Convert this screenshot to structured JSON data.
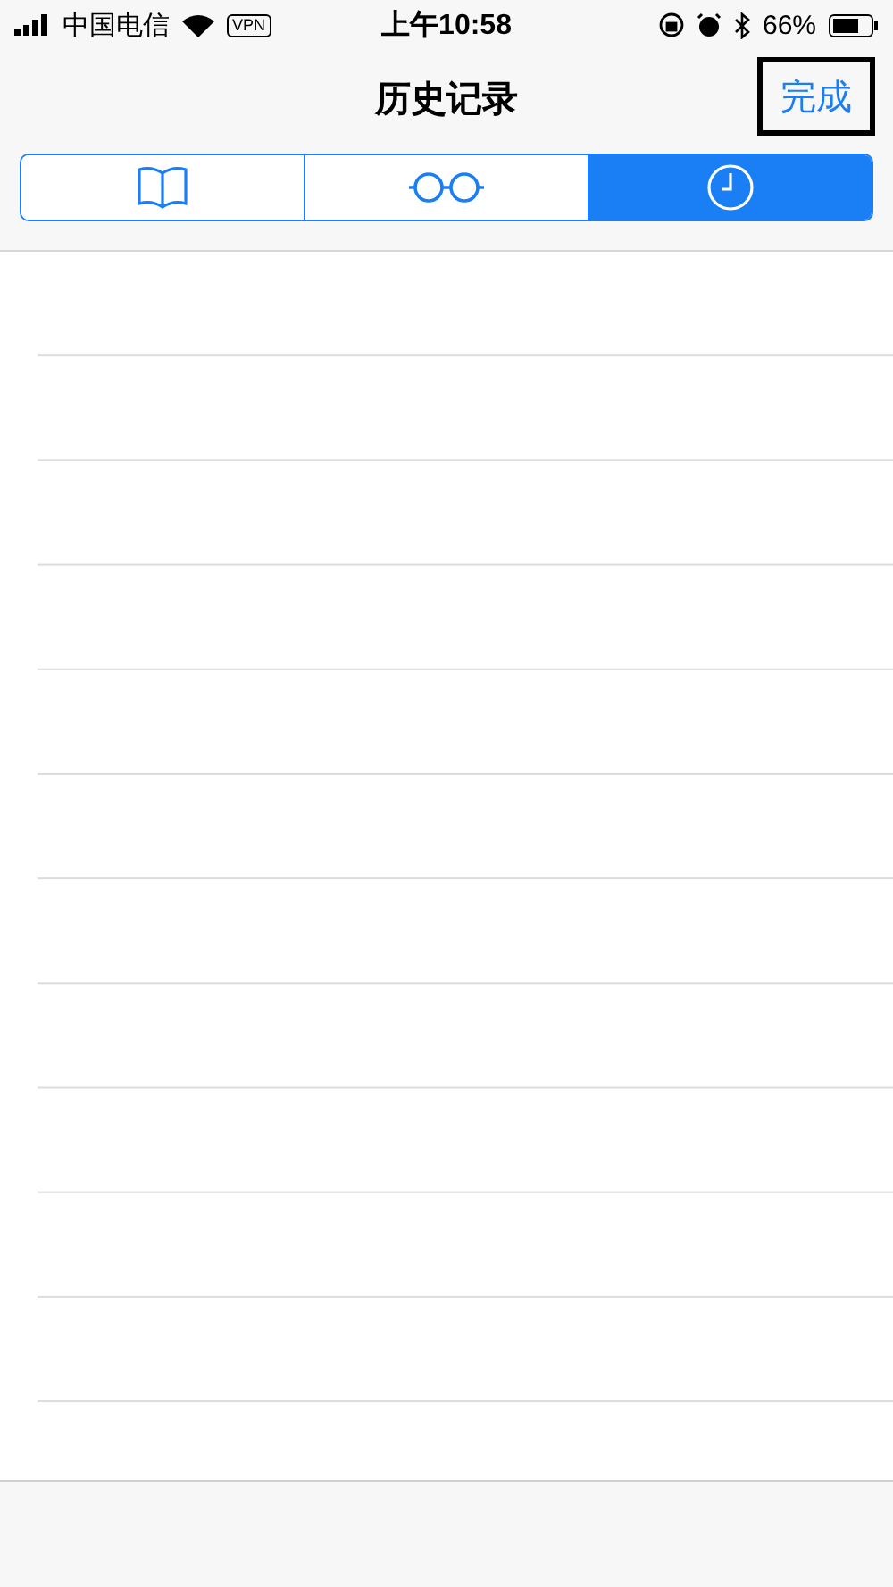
{
  "status_bar": {
    "carrier": "中国电信",
    "vpn": "VPN",
    "time": "上午10:58",
    "battery": "66%"
  },
  "nav": {
    "title": "历史记录",
    "done_button": {
      "label": "完成",
      "highlighted": true
    }
  },
  "segments": [
    {
      "kind": "book",
      "selected": false
    },
    {
      "kind": "glasses",
      "selected": false
    },
    {
      "kind": "clock",
      "selected": true
    }
  ]
}
